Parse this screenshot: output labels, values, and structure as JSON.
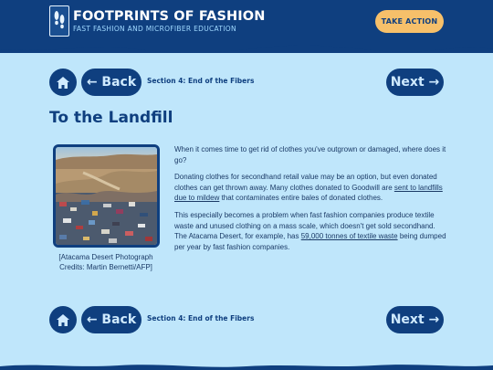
{
  "header": {
    "title": "FOOTPRINTS OF FASHION",
    "subtitle": "FAST FASHION AND MICROFIBER EDUCATION",
    "cta_label": "TAKE ACTION",
    "logo_icon": "footprints-icon"
  },
  "nav": {
    "home_icon": "home-icon",
    "back_label": "← Back",
    "section_label": "Section 4: End of the Fibers",
    "next_label": "Next →"
  },
  "page": {
    "title": "To the Landfill"
  },
  "figure": {
    "caption_line1": "[Atacama Desert Photograph",
    "caption_line2": "Credits: Martin Bernetti/AFP]"
  },
  "content": {
    "p1": "When it comes time to get rid of clothes you've outgrown or damaged, where does it go?",
    "p2_a": "Donating clothes for secondhand retail value may be an option, but even donated clothes can get thrown away. Many clothes donated to Goodwill are ",
    "p2_link": "sent to landfills due to mildew",
    "p2_b": " that contaminates entire bales of donated clothes.",
    "p3_a": "This especially becomes a problem when fast fashion companies produce textile waste and unused clothing on a mass scale, which doesn't get sold secondhand. The Atacama Desert, for example, has ",
    "p3_link": "59,000 tonnes of textile waste",
    "p3_b": " being dumped per year by fast fashion companies."
  },
  "colors": {
    "navy": "#0f3f7f",
    "sky": "#bfe6fb",
    "accent": "#f6c06a"
  }
}
